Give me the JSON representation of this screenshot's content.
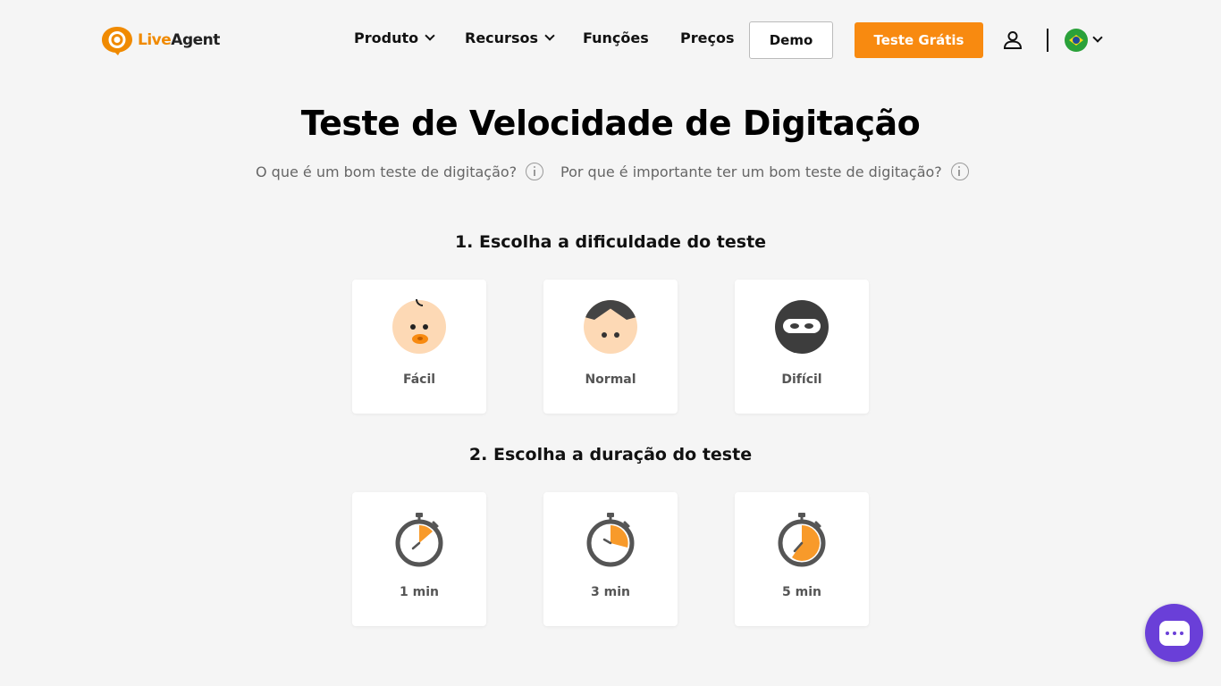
{
  "header": {
    "logo": {
      "live": "Live",
      "agent": "Agent"
    },
    "nav": {
      "produto": "Produto",
      "recursos": "Recursos",
      "funcoes": "Funções",
      "precos": "Preços"
    },
    "demo_label": "Demo",
    "trial_label": "Teste Grátis",
    "user_icon": "user-icon",
    "language_flag": "brazil-flag"
  },
  "main": {
    "title": "Teste de Velocidade de Digitação",
    "question_1": "O que é um bom teste de digitação?",
    "question_2": "Por que é importante ter um bom teste de digitação?",
    "step_1": "1. Escolha a dificuldade do teste",
    "difficulty": [
      {
        "label": "Fácil",
        "icon": "baby-face-icon"
      },
      {
        "label": "Normal",
        "icon": "person-face-icon"
      },
      {
        "label": "Difícil",
        "icon": "ninja-face-icon"
      }
    ],
    "step_2": "2. Escolha a duração do teste",
    "duration": [
      {
        "label": "1 min",
        "icon": "stopwatch-1min-icon"
      },
      {
        "label": "3 min",
        "icon": "stopwatch-3min-icon"
      },
      {
        "label": "5 min",
        "icon": "stopwatch-5min-icon"
      }
    ]
  },
  "chat_widget": {
    "icon": "chat-bubble-icon"
  },
  "colors": {
    "accent": "#f88a10",
    "background": "#f5f5f5",
    "chat": "#6a3fd8"
  }
}
